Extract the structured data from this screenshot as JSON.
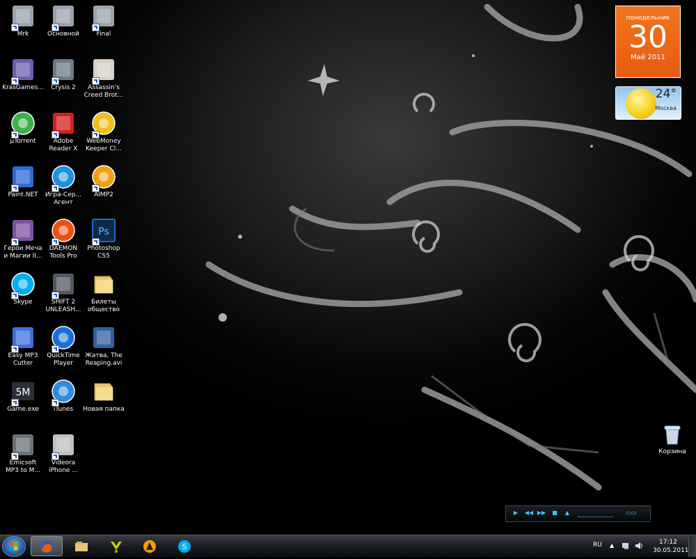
{
  "desktop_icons": [
    {
      "label": "Mrk",
      "icon": "counter-strike-icon",
      "shortcut": true
    },
    {
      "label": "Основной",
      "icon": "counter-strike-icon",
      "shortcut": true
    },
    {
      "label": "Final",
      "icon": "counter-strike-icon",
      "shortcut": true
    },
    {
      "label": "KrasGames...",
      "icon": "shield-icon",
      "shortcut": true
    },
    {
      "label": "Crysis 2",
      "icon": "crysis-icon",
      "shortcut": true
    },
    {
      "label": "Assassin's\nCreed Brot...",
      "icon": "assassins-creed-icon",
      "shortcut": true
    },
    {
      "label": "µTorrent",
      "icon": "utorrent-icon",
      "shortcut": true
    },
    {
      "label": "Adobe\nReader X",
      "icon": "adobe-reader-icon",
      "shortcut": true
    },
    {
      "label": "WebMoney\nKeeper Cl...",
      "icon": "webmoney-icon",
      "shortcut": true
    },
    {
      "label": "Paint.NET",
      "icon": "paint-net-icon",
      "shortcut": true
    },
    {
      "label": "Игра-Сер...\nАгент",
      "icon": "agent-icon",
      "shortcut": true
    },
    {
      "label": "AIMP2",
      "icon": "aimp-icon",
      "shortcut": true
    },
    {
      "label": "Герои Меча\nи Магии II...",
      "icon": "heroes-icon",
      "shortcut": true
    },
    {
      "label": "DAEMON\nTools Pro",
      "icon": "daemon-tools-icon",
      "shortcut": true
    },
    {
      "label": "Photoshop\nCS5",
      "icon": "photoshop-icon",
      "shortcut": true
    },
    {
      "label": "Skype",
      "icon": "skype-icon",
      "shortcut": true
    },
    {
      "label": "SHIFT 2\nUNLEASH...",
      "icon": "shift2-icon",
      "shortcut": true
    },
    {
      "label": "Билеты\nобщество",
      "icon": "folder-icon",
      "shortcut": false
    },
    {
      "label": "Easy MP3\nCutter",
      "icon": "mp3-cutter-icon",
      "shortcut": true
    },
    {
      "label": "QuickTime\nPlayer",
      "icon": "quicktime-icon",
      "shortcut": true
    },
    {
      "label": "Жатва, The\nReaping.avi",
      "icon": "video-file-icon",
      "shortcut": false
    },
    {
      "label": "Game.exe",
      "icon": "game-exe-icon",
      "shortcut": true
    },
    {
      "label": "iTunes",
      "icon": "itunes-icon",
      "shortcut": true
    },
    {
      "label": "Новая папка",
      "icon": "folder-icon",
      "shortcut": false
    },
    {
      "label": "Emicsoft\nMP3 to M...",
      "icon": "emicsoft-icon",
      "shortcut": true
    },
    {
      "label": "Videora\niPhone ...",
      "icon": "videora-icon",
      "shortcut": true
    }
  ],
  "recycle_bin": {
    "label": "Корзина"
  },
  "calendar_gadget": {
    "day_of_week": "понедельник",
    "day": "30",
    "month_year": "Май 2011"
  },
  "weather_gadget": {
    "temperature": "24°",
    "city": "Москва"
  },
  "media_player": {
    "buttons": [
      "play",
      "prev",
      "next",
      "stop",
      "eject"
    ]
  },
  "taskbar": {
    "pinned": [
      "firefox-icon",
      "explorer-icon",
      "game-icon",
      "aimp-icon",
      "skype-icon"
    ],
    "tray": {
      "language": "RU",
      "time": "17:12",
      "date": "30.05.2011"
    }
  },
  "colors": {
    "calendar_orange": "#e8621a",
    "taskbar": "#1c2024"
  }
}
